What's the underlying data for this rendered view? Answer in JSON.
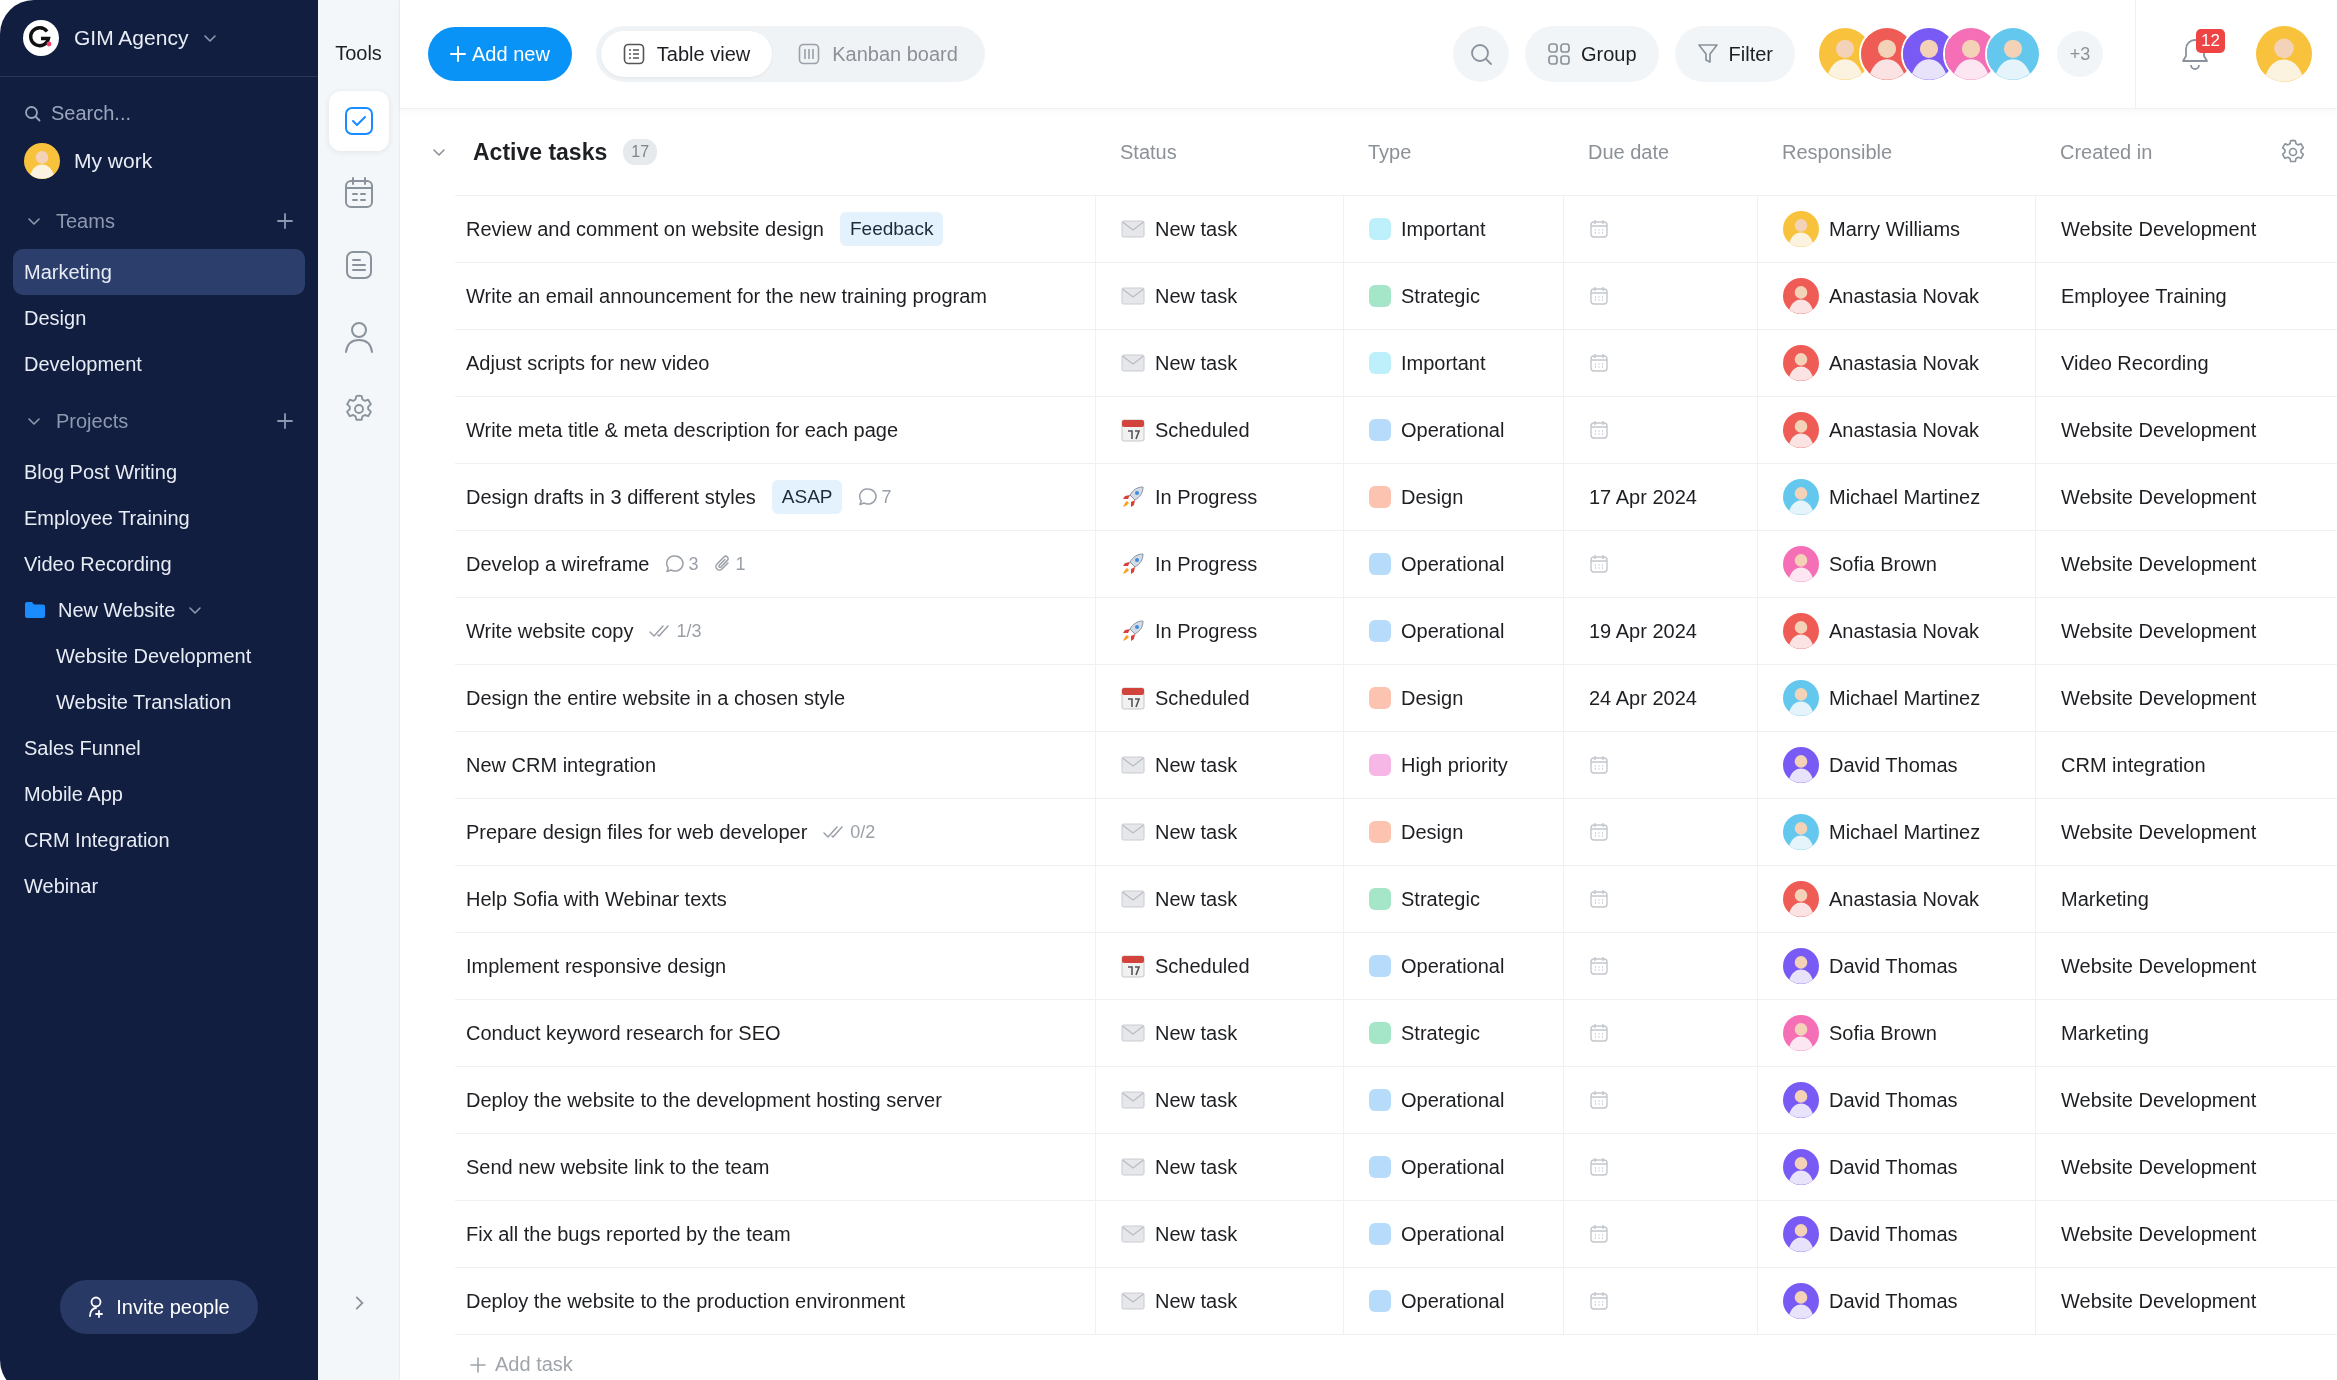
{
  "sidebar": {
    "workspace": "GIM Agency",
    "search": {
      "placeholder": "Search..."
    },
    "my_work": "My work",
    "sections": [
      {
        "title": "Teams",
        "expanded": true,
        "items": [
          {
            "label": "Marketing",
            "selected": true
          },
          {
            "label": "Design",
            "selected": false
          },
          {
            "label": "Development",
            "selected": false
          }
        ]
      },
      {
        "title": "Projects",
        "expanded": true,
        "items": [
          {
            "label": "Blog Post Writing",
            "selected": false
          },
          {
            "label": "Employee Training",
            "selected": false
          },
          {
            "label": "Video Recording",
            "selected": false
          },
          {
            "label": "New Website",
            "kind": "folder",
            "expanded": true,
            "selected": false,
            "children": [
              {
                "label": "Website Development",
                "selected": false
              },
              {
                "label": "Website Translation",
                "selected": false
              }
            ]
          },
          {
            "label": "Sales Funnel",
            "selected": false
          },
          {
            "label": "Mobile App",
            "selected": false
          },
          {
            "label": "CRM Integration",
            "selected": false
          },
          {
            "label": "Webinar",
            "selected": false
          }
        ]
      }
    ],
    "invite_button": "Invite people"
  },
  "tools": {
    "title": "Tools",
    "items": [
      {
        "kind": "tasks",
        "selected": true
      },
      {
        "kind": "calendar",
        "selected": false
      },
      {
        "kind": "notes",
        "selected": false
      },
      {
        "kind": "people",
        "selected": false
      },
      {
        "kind": "settings",
        "selected": false
      }
    ]
  },
  "toolbar": {
    "add_button": "Add new",
    "views": [
      {
        "label": "Table view",
        "kind": "table",
        "selected": true
      },
      {
        "label": "Kanban board",
        "kind": "kanban",
        "selected": false
      }
    ],
    "group_button": "Group",
    "filter_button": "Filter",
    "members": [
      {
        "color": "#f9c23c"
      },
      {
        "color": "#ef5b55"
      },
      {
        "color": "#7a5af5"
      },
      {
        "color": "#f46fb5"
      },
      {
        "color": "#64c8ee"
      }
    ],
    "more_members": "+3",
    "notifications": "12"
  },
  "table": {
    "section": {
      "title": "Active tasks",
      "count": "17",
      "expanded": true
    },
    "columns": [
      "Status",
      "Type",
      "Due date",
      "Responsible",
      "Created in"
    ],
    "rows": [
      {
        "title": "Review and comment on website design",
        "badges": [
          {
            "kind": "tag",
            "text": "Feedback"
          }
        ],
        "status": {
          "kind": "new",
          "label": "New task"
        },
        "type": {
          "label": "Important",
          "color": "#bdf0fa"
        },
        "responsible": {
          "name": "Marry Williams",
          "color": "#f9c23c"
        },
        "created_in": "Website Development"
      },
      {
        "title": "Write an email announcement for the new training program",
        "badges": [],
        "status": {
          "kind": "new",
          "label": "New task"
        },
        "type": {
          "label": "Strategic",
          "color": "#a5e6c8"
        },
        "responsible": {
          "name": "Anastasia Novak",
          "color": "#ef5b55"
        },
        "created_in": "Employee Training"
      },
      {
        "title": "Adjust scripts for new video",
        "badges": [],
        "status": {
          "kind": "new",
          "label": "New task"
        },
        "type": {
          "label": "Important",
          "color": "#bdf0fa"
        },
        "responsible": {
          "name": "Anastasia Novak",
          "color": "#ef5b55"
        },
        "created_in": "Video Recording"
      },
      {
        "title": "Write meta title & meta description for each page",
        "badges": [],
        "status": {
          "kind": "scheduled",
          "label": "Scheduled"
        },
        "type": {
          "label": "Operational",
          "color": "#b7dcfb"
        },
        "responsible": {
          "name": "Anastasia Novak",
          "color": "#ef5b55"
        },
        "created_in": "Website Development"
      },
      {
        "title": "Design drafts in 3 different styles",
        "badges": [
          {
            "kind": "tag",
            "text": "ASAP"
          },
          {
            "kind": "comments",
            "text": "7"
          }
        ],
        "status": {
          "kind": "in_progress",
          "label": "In Progress"
        },
        "type": {
          "label": "Design",
          "color": "#fcc3b0"
        },
        "due_date": "17 Apr 2024",
        "responsible": {
          "name": "Michael Martinez",
          "color": "#64c8ee"
        },
        "created_in": "Website Development"
      },
      {
        "title": "Develop a wireframe",
        "badges": [
          {
            "kind": "comments",
            "text": "3"
          },
          {
            "kind": "attachments",
            "text": "1"
          }
        ],
        "status": {
          "kind": "in_progress",
          "label": "In Progress"
        },
        "type": {
          "label": "Operational",
          "color": "#b7dcfb"
        },
        "responsible": {
          "name": "Sofia Brown",
          "color": "#f46fb5"
        },
        "created_in": "Website Development"
      },
      {
        "title": "Write website copy",
        "badges": [
          {
            "kind": "checklist",
            "text": "1/3"
          }
        ],
        "status": {
          "kind": "in_progress",
          "label": "In Progress"
        },
        "type": {
          "label": "Operational",
          "color": "#b7dcfb"
        },
        "due_date": "19 Apr 2024",
        "responsible": {
          "name": "Anastasia Novak",
          "color": "#ef5b55"
        },
        "created_in": "Website Development"
      },
      {
        "title": "Design the entire website in a chosen style",
        "badges": [],
        "status": {
          "kind": "scheduled",
          "label": "Scheduled"
        },
        "type": {
          "label": "Design",
          "color": "#fcc3b0"
        },
        "due_date": "24 Apr 2024",
        "responsible": {
          "name": "Michael Martinez",
          "color": "#64c8ee"
        },
        "created_in": "Website Development"
      },
      {
        "title": "New CRM integration",
        "badges": [],
        "status": {
          "kind": "new",
          "label": "New task"
        },
        "type": {
          "label": "High priority",
          "color": "#f6b6e6"
        },
        "responsible": {
          "name": "David Thomas",
          "color": "#7a5af5"
        },
        "created_in": "CRM integration"
      },
      {
        "title": "Prepare design files for web developer",
        "badges": [
          {
            "kind": "checklist",
            "text": "0/2"
          }
        ],
        "status": {
          "kind": "new",
          "label": "New task"
        },
        "type": {
          "label": "Design",
          "color": "#fcc3b0"
        },
        "responsible": {
          "name": "Michael Martinez",
          "color": "#64c8ee"
        },
        "created_in": "Website Development"
      },
      {
        "title": "Help Sofia with Webinar texts",
        "badges": [],
        "status": {
          "kind": "new",
          "label": "New task"
        },
        "type": {
          "label": "Strategic",
          "color": "#a5e6c8"
        },
        "responsible": {
          "name": "Anastasia Novak",
          "color": "#ef5b55"
        },
        "created_in": "Marketing"
      },
      {
        "title": "Implement responsive design",
        "badges": [],
        "status": {
          "kind": "scheduled",
          "label": "Scheduled"
        },
        "type": {
          "label": "Operational",
          "color": "#b7dcfb"
        },
        "responsible": {
          "name": "David Thomas",
          "color": "#7a5af5"
        },
        "created_in": "Website Development"
      },
      {
        "title": "Conduct keyword research for SEO",
        "badges": [],
        "status": {
          "kind": "new",
          "label": "New task"
        },
        "type": {
          "label": "Strategic",
          "color": "#a5e6c8"
        },
        "responsible": {
          "name": "Sofia Brown",
          "color": "#f46fb5"
        },
        "created_in": "Marketing"
      },
      {
        "title": "Deploy the website to the development hosting server",
        "badges": [],
        "status": {
          "kind": "new",
          "label": "New task"
        },
        "type": {
          "label": "Operational",
          "color": "#b7dcfb"
        },
        "responsible": {
          "name": "David Thomas",
          "color": "#7a5af5"
        },
        "created_in": "Website Development"
      },
      {
        "title": "Send new website link to the team",
        "badges": [],
        "status": {
          "kind": "new",
          "label": "New task"
        },
        "type": {
          "label": "Operational",
          "color": "#b7dcfb"
        },
        "responsible": {
          "name": "David Thomas",
          "color": "#7a5af5"
        },
        "created_in": "Website Development"
      },
      {
        "title": "Fix all the bugs reported by the team",
        "badges": [],
        "status": {
          "kind": "new",
          "label": "New task"
        },
        "type": {
          "label": "Operational",
          "color": "#b7dcfb"
        },
        "responsible": {
          "name": "David Thomas",
          "color": "#7a5af5"
        },
        "created_in": "Website Development"
      },
      {
        "title": "Deploy the website to the production environment",
        "badges": [],
        "status": {
          "kind": "new",
          "label": "New task"
        },
        "type": {
          "label": "Operational",
          "color": "#b7dcfb"
        },
        "responsible": {
          "name": "David Thomas",
          "color": "#7a5af5"
        },
        "created_in": "Website Development"
      }
    ],
    "add_task": "Add task"
  }
}
